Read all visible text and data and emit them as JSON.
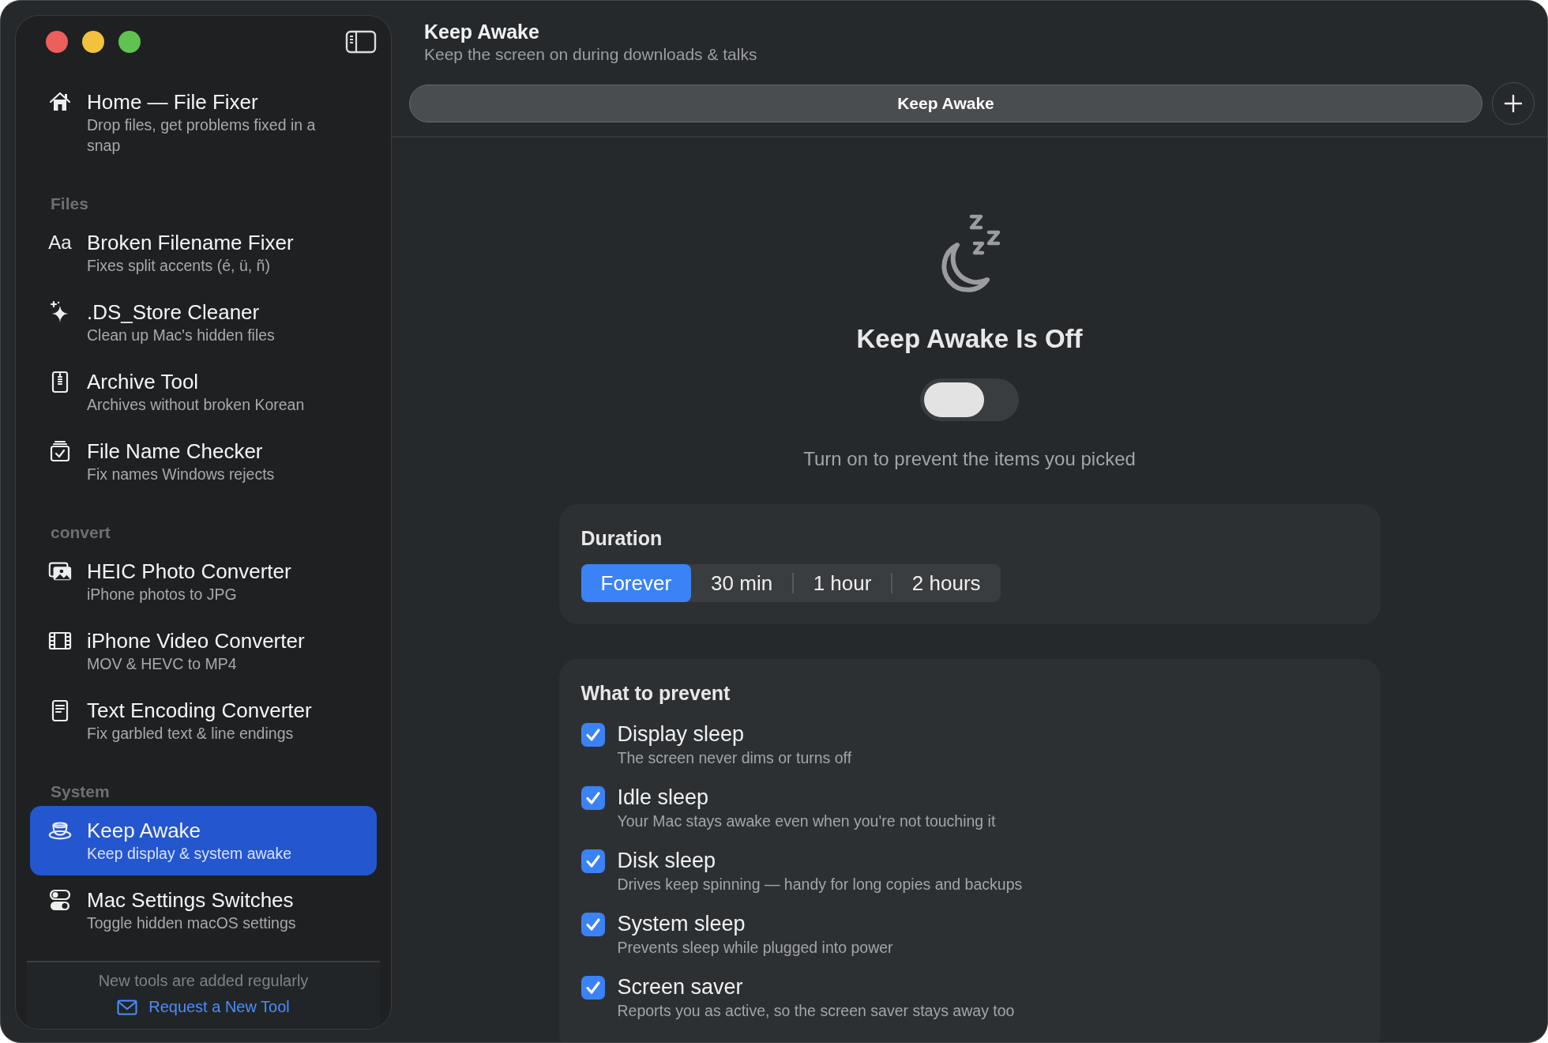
{
  "sidebar": {
    "home": {
      "title": "Home — File Fixer",
      "subtitle": "Drop files, get problems fixed in a snap",
      "selected": false
    },
    "sections": [
      {
        "header": "Files",
        "items": [
          {
            "title": "Broken Filename Fixer",
            "subtitle": "Fixes split accents (é, ü, ñ)",
            "glyph": "Aa",
            "selected": false
          },
          {
            "title": ".DS_Store Cleaner",
            "subtitle": "Clean up Mac's hidden files",
            "selected": false
          },
          {
            "title": "Archive Tool",
            "subtitle": "Archives without broken Korean",
            "selected": false
          },
          {
            "title": "File Name Checker",
            "subtitle": "Fix names Windows rejects",
            "selected": false
          }
        ]
      },
      {
        "header": "convert",
        "items": [
          {
            "title": "HEIC Photo Converter",
            "subtitle": "iPhone photos to JPG",
            "selected": false
          },
          {
            "title": "iPhone Video Converter",
            "subtitle": "MOV & HEVC to MP4",
            "selected": false
          },
          {
            "title": "Text Encoding Converter",
            "subtitle": "Fix garbled text & line endings",
            "selected": false
          }
        ]
      },
      {
        "header": "System",
        "items": [
          {
            "title": "Keep Awake",
            "subtitle": "Keep display & system awake",
            "selected": true
          },
          {
            "title": "Mac Settings Switches",
            "subtitle": "Toggle hidden macOS settings",
            "selected": false
          }
        ]
      }
    ],
    "footer": {
      "note": "New tools are added regularly",
      "link": "Request a New Tool"
    }
  },
  "header": {
    "title": "Keep Awake",
    "subtitle": "Keep the screen on during downloads & talks"
  },
  "tab": {
    "label": "Keep Awake"
  },
  "status": {
    "title": "Keep Awake Is Off",
    "on": false,
    "caption": "Turn on to prevent the items you picked"
  },
  "duration": {
    "heading": "Duration",
    "options": [
      {
        "label": "Forever",
        "selected": true
      },
      {
        "label": "30 min",
        "selected": false
      },
      {
        "label": "1 hour",
        "selected": false
      },
      {
        "label": "2 hours",
        "selected": false
      }
    ]
  },
  "prevent": {
    "heading": "What to prevent",
    "items": [
      {
        "title": "Display sleep",
        "subtitle": "The screen never dims or turns off",
        "checked": true
      },
      {
        "title": "Idle sleep",
        "subtitle": "Your Mac stays awake even when you're not touching it",
        "checked": true
      },
      {
        "title": "Disk sleep",
        "subtitle": "Drives keep spinning — handy for long copies and backups",
        "checked": true
      },
      {
        "title": "System sleep",
        "subtitle": "Prevents sleep while plugged into power",
        "checked": true
      },
      {
        "title": "Screen saver",
        "subtitle": "Reports you as active, so the screen saver stays away too",
        "checked": true
      }
    ]
  }
}
